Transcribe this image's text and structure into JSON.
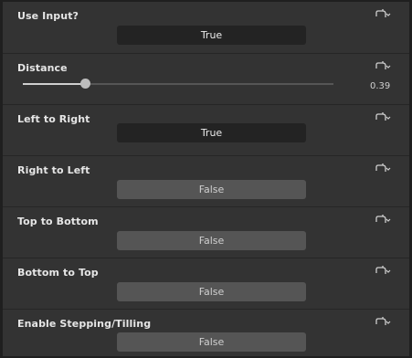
{
  "rows": [
    {
      "label": "Use Input?",
      "value": "True"
    },
    {
      "label": "Distance",
      "slider_value": "0.39"
    },
    {
      "label": "Left to Right",
      "value": "True"
    },
    {
      "label": "Right to Left",
      "value": "False"
    },
    {
      "label": "Top to Bottom",
      "value": "False"
    },
    {
      "label": "Bottom to Top",
      "value": "False"
    },
    {
      "label": "Enable Stepping/Tilling",
      "value": "False"
    }
  ],
  "distance_fraction": 0.2,
  "icons": {
    "reset": "reset-curve-icon"
  },
  "colors": {
    "panel_bg": "#333333",
    "toggle_on_bg": "#232323",
    "toggle_off_bg": "#555555",
    "text": "#e6e6e6"
  }
}
